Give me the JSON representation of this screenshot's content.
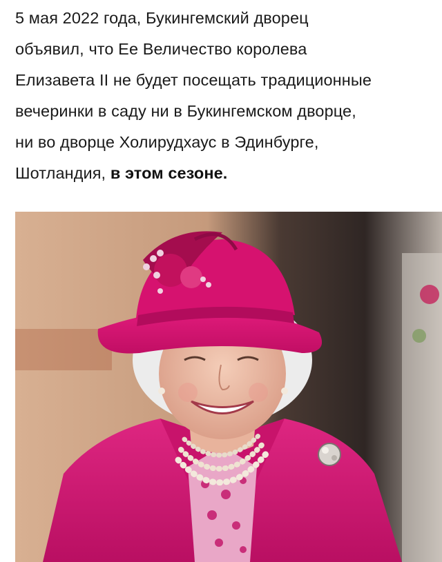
{
  "article": {
    "line1": "5 мая 2022 года, Букингемский дворец",
    "line2": "объявил, что Ее Величество королева",
    "line3": "Елизавета II не будет посещать традиционные",
    "line4": "вечеринки в саду ни в Букингемском дворце,",
    "line5": "ни во дворце Холирудхаус в Эдинбурге,",
    "line6_plain": "Шотландия, ",
    "line6_bold": "в этом сезоне."
  },
  "photo": {
    "subject": "queen-portrait",
    "colors": {
      "hat": "#d4116e",
      "coat": "#d21a77",
      "background_warm": "#caa284",
      "background_dark": "#3a2e2a",
      "pearls": "#f1e6d8",
      "hair": "#eeeeee",
      "skin": "#efc2ad"
    }
  }
}
